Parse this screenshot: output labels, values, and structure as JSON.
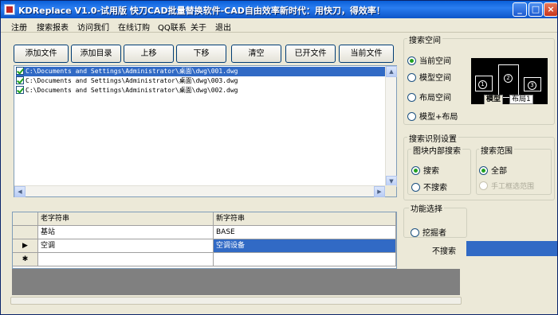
{
  "title": "KDReplace V1.0-试用版 快刀CAD批量替换软件-CAD自由效率新时代：用快刀，得效率！",
  "window_buttons": {
    "minimize": "_",
    "maximize": "□",
    "close": "×"
  },
  "menu": [
    "注册",
    "搜索报表",
    "访问我们",
    "在线订购",
    "QQ联系",
    "关于",
    "退出"
  ],
  "toolbar": [
    "添加文件",
    "添加目录",
    "上移",
    "下移",
    "清空",
    "已开文件",
    "当前文件"
  ],
  "files": [
    {
      "path": "C:\\Documents and Settings\\Administrator\\桌面\\dwg\\001.dwg",
      "checked": true,
      "selected": true
    },
    {
      "path": "C:\\Documents and Settings\\Administrator\\桌面\\dwg\\003.dwg",
      "checked": true,
      "selected": false
    },
    {
      "path": "C:\\Documents and Settings\\Administrator\\桌面\\dwg\\002.dwg",
      "checked": true,
      "selected": false
    }
  ],
  "grid": {
    "headers": [
      "老字符串",
      "新字符串"
    ],
    "rows": [
      {
        "indicator": "",
        "old": "基站",
        "new": "BASE"
      },
      {
        "indicator": "▶",
        "old": "空调",
        "new": "空调设备"
      },
      {
        "indicator": "✱",
        "old": "",
        "new": ""
      }
    ]
  },
  "search_space": {
    "title": "搜索空间",
    "options": [
      "当前空间",
      "模型空间",
      "布局空间",
      "模型+布局"
    ],
    "selected": "当前空间"
  },
  "preview": {
    "numbers": [
      "①",
      "②",
      "③"
    ],
    "tabs": [
      "模型",
      "布局1",
      "/"
    ],
    "nav": "|◂ ▸"
  },
  "recognition": {
    "title": "搜索识别设置",
    "block_search": {
      "title": "图块内部搜索",
      "options": [
        "搜索",
        "不搜索"
      ],
      "selected": "搜索"
    },
    "search_range": {
      "title": "搜索范围",
      "options": [
        "全部",
        "手工框选范围"
      ],
      "selected": "全部"
    }
  },
  "function": {
    "title": "功能选择",
    "option": "挖掘者",
    "label": "不搜索"
  }
}
